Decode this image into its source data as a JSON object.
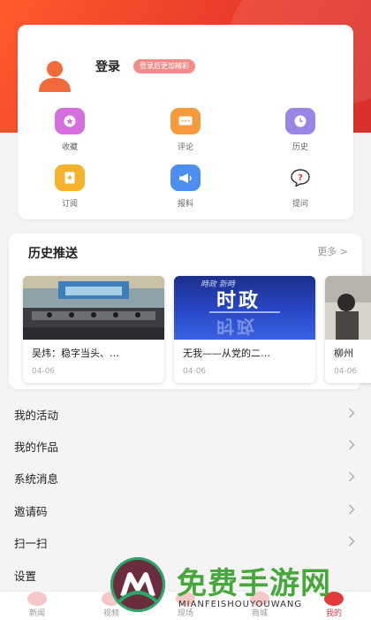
{
  "profile": {
    "login_label": "登录",
    "login_tag": "登录后更加精彩"
  },
  "features": [
    {
      "label": "收藏",
      "icon": "star-icon",
      "color": "#d66ee0"
    },
    {
      "label": "评论",
      "icon": "comment-icon",
      "color": "#f89a3c"
    },
    {
      "label": "历史",
      "icon": "clock-icon",
      "color": "#9b86e8"
    },
    {
      "label": "订阅",
      "icon": "bookmark-icon",
      "color": "#f5b22c"
    },
    {
      "label": "报料",
      "icon": "megaphone-icon",
      "color": "#4d8ef3"
    },
    {
      "label": "提问",
      "icon": "question-icon",
      "color": "#e23b3b"
    }
  ],
  "history": {
    "title": "历史推送",
    "more": "更多 >",
    "items": [
      {
        "title": "吴炜：稳字当头、…",
        "date": "04-06"
      },
      {
        "title": "无我——从党的二…",
        "date": "04-06",
        "banner_top": "時政 新時",
        "banner_main": "时政"
      },
      {
        "title": "柳州",
        "date": "04-06"
      }
    ]
  },
  "menu": [
    "我的活动",
    "我的作品",
    "系统消息",
    "邀请码",
    "扫一扫",
    "设置"
  ],
  "tabs": [
    "新闻",
    "视频",
    "现场",
    "商城",
    "我的"
  ],
  "watermark": {
    "cn": "免费手游网",
    "en": "MIANFEISHOUYOUWANG"
  }
}
